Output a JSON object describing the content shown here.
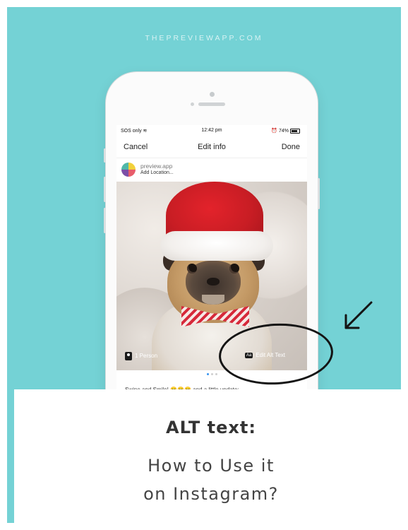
{
  "site": {
    "label": "THEPREVIEWAPP.COM"
  },
  "status_bar": {
    "carrier": "SOS only",
    "wifi": "wifi-icon",
    "time": "12:42 pm",
    "alarm": "alarm-icon",
    "battery": "74%"
  },
  "nav": {
    "cancel": "Cancel",
    "title": "Edit info",
    "done": "Done"
  },
  "account": {
    "name": "preview.app",
    "location": "Add Location..."
  },
  "photo": {
    "description_icon": "pug-photo",
    "tag_people": "1 Person",
    "edit_alt_text": "Edit Alt Text",
    "aa_label": "Aa"
  },
  "carousel": {
    "count": 3,
    "active": 1
  },
  "caption": {
    "text": "Swipe and Smile! 😄😄😄 and a little update:"
  },
  "banner": {
    "title": "ALT text:",
    "line1": "How to Use it",
    "line2": "on Instagram?"
  },
  "colors": {
    "background": "#74d2d5",
    "panel": "#ffffff",
    "accent": "#3a95ef"
  }
}
